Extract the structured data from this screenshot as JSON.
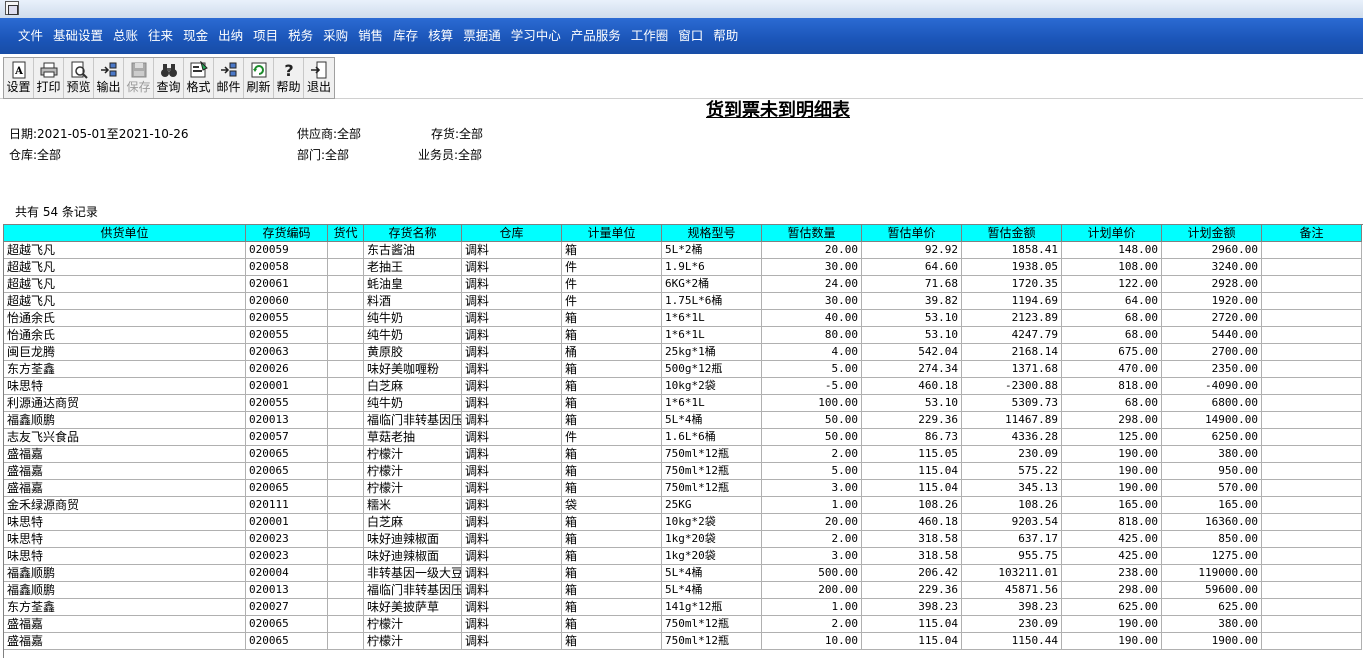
{
  "menu": [
    "文件",
    "基础设置",
    "总账",
    "往来",
    "现金",
    "出纳",
    "项目",
    "税务",
    "采购",
    "销售",
    "库存",
    "核算",
    "票据通",
    "学习中心",
    "产品服务",
    "工作圈",
    "窗口",
    "帮助"
  ],
  "toolbar": [
    {
      "label": "设置",
      "icon": "settings-doc-icon",
      "enabled": true
    },
    {
      "label": "打印",
      "icon": "printer-icon",
      "enabled": true
    },
    {
      "label": "预览",
      "icon": "preview-icon",
      "enabled": true
    },
    {
      "label": "输出",
      "icon": "export-icon",
      "enabled": true
    },
    {
      "label": "保存",
      "icon": "save-icon",
      "enabled": false
    },
    {
      "label": "查询",
      "icon": "binoculars-icon",
      "enabled": true
    },
    {
      "label": "格式",
      "icon": "format-icon",
      "enabled": true
    },
    {
      "label": "邮件",
      "icon": "mail-icon",
      "enabled": true
    },
    {
      "label": "刷新",
      "icon": "refresh-icon",
      "enabled": true
    },
    {
      "label": "帮助",
      "icon": "help-icon",
      "enabled": true
    },
    {
      "label": "退出",
      "icon": "exit-icon",
      "enabled": true
    }
  ],
  "report": {
    "title": "货到票未到明细表",
    "date": "日期:2021-05-01至2021-10-26",
    "supplier": "供应商:全部",
    "inventory": "存货:全部",
    "warehouse": "仓库:全部",
    "department": "部门:全部",
    "salesperson": "业务员:全部",
    "record_count": "共有 54 条记录"
  },
  "table": {
    "columns": [
      "供货单位",
      "存货编码",
      "货代",
      "存货名称",
      "仓库",
      "计量单位",
      "规格型号",
      "暂估数量",
      "暂估单价",
      "暂估金额",
      "计划单价",
      "计划金额",
      "备注"
    ],
    "rows": [
      [
        "超越飞凡",
        "020059",
        "",
        "东古酱油",
        "调料",
        "箱",
        "5L*2桶",
        "20.00",
        "92.92",
        "1858.41",
        "148.00",
        "2960.00",
        ""
      ],
      [
        "超越飞凡",
        "020058",
        "",
        "老抽王",
        "调料",
        "件",
        "1.9L*6",
        "30.00",
        "64.60",
        "1938.05",
        "108.00",
        "3240.00",
        ""
      ],
      [
        "超越飞凡",
        "020061",
        "",
        "蚝油皇",
        "调料",
        "件",
        "6KG*2桶",
        "24.00",
        "71.68",
        "1720.35",
        "122.00",
        "2928.00",
        ""
      ],
      [
        "超越飞凡",
        "020060",
        "",
        "料酒",
        "调料",
        "件",
        "1.75L*6桶",
        "30.00",
        "39.82",
        "1194.69",
        "64.00",
        "1920.00",
        ""
      ],
      [
        "怡通余氏",
        "020055",
        "",
        "纯牛奶",
        "调料",
        "箱",
        "1*6*1L",
        "40.00",
        "53.10",
        "2123.89",
        "68.00",
        "2720.00",
        ""
      ],
      [
        "怡通余氏",
        "020055",
        "",
        "纯牛奶",
        "调料",
        "箱",
        "1*6*1L",
        "80.00",
        "53.10",
        "4247.79",
        "68.00",
        "5440.00",
        ""
      ],
      [
        "闽巨龙腾",
        "020063",
        "",
        "黄原胶",
        "调料",
        "桶",
        "25kg*1桶",
        "4.00",
        "542.04",
        "2168.14",
        "675.00",
        "2700.00",
        ""
      ],
      [
        "东方荃鑫",
        "020026",
        "",
        "味好美咖喱粉",
        "调料",
        "箱",
        "500g*12瓶",
        "5.00",
        "274.34",
        "1371.68",
        "470.00",
        "2350.00",
        ""
      ],
      [
        "味思特",
        "020001",
        "",
        "白芝麻",
        "调料",
        "箱",
        "10kg*2袋",
        "-5.00",
        "460.18",
        "-2300.88",
        "818.00",
        "-4090.00",
        ""
      ],
      [
        "利源通达商贸",
        "020055",
        "",
        "纯牛奶",
        "调料",
        "箱",
        "1*6*1L",
        "100.00",
        "53.10",
        "5309.73",
        "68.00",
        "6800.00",
        ""
      ],
      [
        "福鑫顺鹏",
        "020013",
        "",
        "福临门非转基因压",
        "调料",
        "箱",
        "5L*4桶",
        "50.00",
        "229.36",
        "11467.89",
        "298.00",
        "14900.00",
        ""
      ],
      [
        "志友飞兴食品",
        "020057",
        "",
        "草菇老抽",
        "调料",
        "件",
        "1.6L*6桶",
        "50.00",
        "86.73",
        "4336.28",
        "125.00",
        "6250.00",
        ""
      ],
      [
        "盛福嘉",
        "020065",
        "",
        "柠檬汁",
        "调料",
        "箱",
        "750ml*12瓶",
        "2.00",
        "115.05",
        "230.09",
        "190.00",
        "380.00",
        ""
      ],
      [
        "盛福嘉",
        "020065",
        "",
        "柠檬汁",
        "调料",
        "箱",
        "750ml*12瓶",
        "5.00",
        "115.04",
        "575.22",
        "190.00",
        "950.00",
        ""
      ],
      [
        "盛福嘉",
        "020065",
        "",
        "柠檬汁",
        "调料",
        "箱",
        "750ml*12瓶",
        "3.00",
        "115.04",
        "345.13",
        "190.00",
        "570.00",
        ""
      ],
      [
        "金禾绿源商贸",
        "020111",
        "",
        "糯米",
        "调料",
        "袋",
        "25KG",
        "1.00",
        "108.26",
        "108.26",
        "165.00",
        "165.00",
        ""
      ],
      [
        "味思特",
        "020001",
        "",
        "白芝麻",
        "调料",
        "箱",
        "10kg*2袋",
        "20.00",
        "460.18",
        "9203.54",
        "818.00",
        "16360.00",
        ""
      ],
      [
        "味思特",
        "020023",
        "",
        "味好迪辣椒面",
        "调料",
        "箱",
        "1kg*20袋",
        "2.00",
        "318.58",
        "637.17",
        "425.00",
        "850.00",
        ""
      ],
      [
        "味思特",
        "020023",
        "",
        "味好迪辣椒面",
        "调料",
        "箱",
        "1kg*20袋",
        "3.00",
        "318.58",
        "955.75",
        "425.00",
        "1275.00",
        ""
      ],
      [
        "福鑫顺鹏",
        "020004",
        "",
        "非转基因一级大豆",
        "调料",
        "箱",
        "5L*4桶",
        "500.00",
        "206.42",
        "103211.01",
        "238.00",
        "119000.00",
        ""
      ],
      [
        "福鑫顺鹏",
        "020013",
        "",
        "福临门非转基因压",
        "调料",
        "箱",
        "5L*4桶",
        "200.00",
        "229.36",
        "45871.56",
        "298.00",
        "59600.00",
        ""
      ],
      [
        "东方荃鑫",
        "020027",
        "",
        "味好美披萨草",
        "调料",
        "箱",
        "141g*12瓶",
        "1.00",
        "398.23",
        "398.23",
        "625.00",
        "625.00",
        ""
      ],
      [
        "盛福嘉",
        "020065",
        "",
        "柠檬汁",
        "调料",
        "箱",
        "750ml*12瓶",
        "2.00",
        "115.04",
        "230.09",
        "190.00",
        "380.00",
        ""
      ],
      [
        "盛福嘉",
        "020065",
        "",
        "柠檬汁",
        "调料",
        "箱",
        "750ml*12瓶",
        "10.00",
        "115.04",
        "1150.44",
        "190.00",
        "1900.00",
        ""
      ]
    ]
  }
}
